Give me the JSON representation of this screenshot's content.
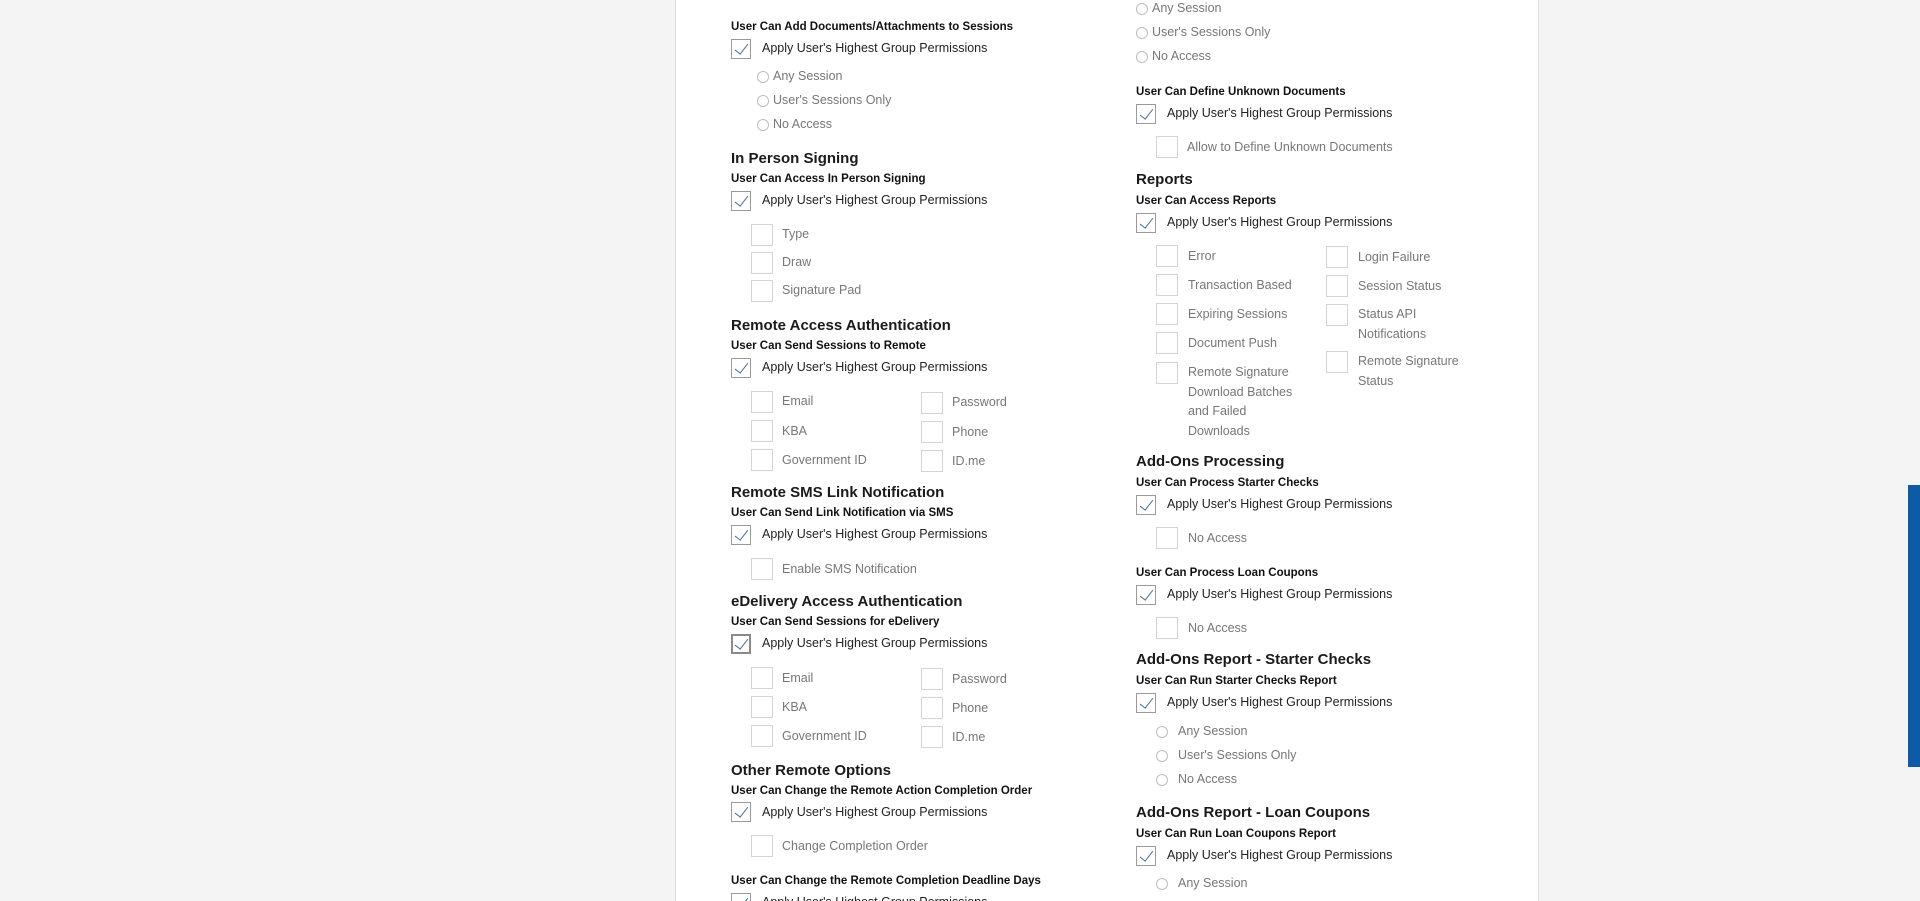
{
  "apply_label": "Apply User's Highest Group Permissions",
  "left": {
    "add_docs": {
      "subheading": "User Can Add Documents/Attachments to Sessions",
      "options": [
        "Any Session",
        "User's Sessions Only",
        "No Access"
      ]
    },
    "in_person": {
      "heading": "In Person Signing",
      "subheading": "User Can Access In Person Signing",
      "options": [
        "Type",
        "Draw",
        "Signature Pad"
      ]
    },
    "remote_auth": {
      "heading": "Remote Access Authentication",
      "subheading": "User Can Send Sessions to Remote",
      "options_left": [
        "Email",
        "KBA",
        "Government ID"
      ],
      "options_right": [
        "Password",
        "Phone",
        "ID.me"
      ]
    },
    "sms": {
      "heading": "Remote SMS Link Notification",
      "subheading": "User Can Send Link Notification via SMS",
      "options": [
        "Enable SMS Notification"
      ]
    },
    "edelivery": {
      "heading": "eDelivery Access Authentication",
      "subheading": "User Can Send Sessions for eDelivery",
      "options_left": [
        "Email",
        "KBA",
        "Government ID"
      ],
      "options_right": [
        "Password",
        "Phone",
        "ID.me"
      ]
    },
    "other_remote": {
      "heading": "Other Remote Options",
      "subheading": "User Can Change the Remote Action Completion Order",
      "options": [
        "Change Completion Order"
      ],
      "subheading2": "User Can Change the Remote Completion Deadline Days"
    }
  },
  "right": {
    "top_options": [
      "Any Session",
      "User's Sessions Only",
      "No Access"
    ],
    "define_unknown": {
      "subheading": "User Can Define Unknown Documents",
      "options": [
        "Allow to Define Unknown Documents"
      ]
    },
    "reports": {
      "heading": "Reports",
      "subheading": "User Can Access Reports",
      "options_left": [
        "Error",
        "Transaction Based",
        "Expiring Sessions",
        "Document Push",
        "Remote Signature Download Batches and Failed Downloads"
      ],
      "options_right": [
        "Login Failure",
        "Session Status",
        "Status API Notifications",
        "Remote Signature Status"
      ]
    },
    "addons_processing": {
      "heading": "Add-Ons Processing",
      "subheading": "User Can Process Starter Checks",
      "options": [
        "No Access"
      ],
      "subheading2": "User Can Process Loan Coupons",
      "options2": [
        "No Access"
      ]
    },
    "starter_report": {
      "heading": "Add-Ons Report - Starter Checks",
      "subheading": "User Can Run Starter Checks Report",
      "options": [
        "Any Session",
        "User's Sessions Only",
        "No Access"
      ]
    },
    "loan_report": {
      "heading": "Add-Ons Report - Loan Coupons",
      "subheading": "User Can Run Loan Coupons Report",
      "options": [
        "Any Session"
      ]
    }
  }
}
